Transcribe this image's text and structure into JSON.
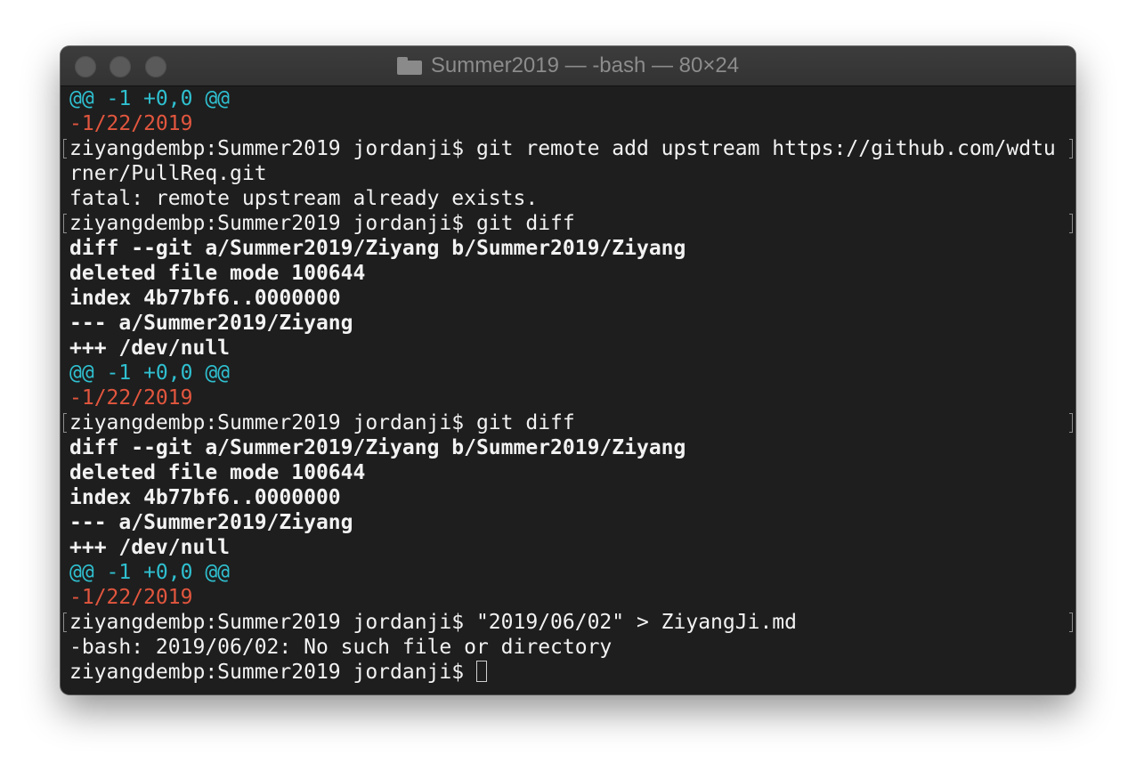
{
  "window": {
    "title": "Summer2019 — -bash — 80×24"
  },
  "terminal": {
    "lines": [
      {
        "text": "@@ -1 +0,0 @@",
        "style": "hunk"
      },
      {
        "text": "-1/22/2019",
        "style": "deleted"
      },
      {
        "text": "ziyangdembp:Summer2019 jordanji$ git remote add upstream https://github.com/wdtu",
        "style": "prompt"
      },
      {
        "text": "rner/PullReq.git",
        "style": "normal"
      },
      {
        "text": "fatal: remote upstream already exists.",
        "style": "normal"
      },
      {
        "text": "ziyangdembp:Summer2019 jordanji$ git diff",
        "style": "prompt"
      },
      {
        "text": "diff --git a/Summer2019/Ziyang b/Summer2019/Ziyang",
        "style": "bold"
      },
      {
        "text": "deleted file mode 100644",
        "style": "bold"
      },
      {
        "text": "index 4b77bf6..0000000",
        "style": "bold"
      },
      {
        "text": "--- a/Summer2019/Ziyang",
        "style": "bold"
      },
      {
        "text": "+++ /dev/null",
        "style": "bold"
      },
      {
        "text": "@@ -1 +0,0 @@",
        "style": "hunk"
      },
      {
        "text": "-1/22/2019",
        "style": "deleted"
      },
      {
        "text": "ziyangdembp:Summer2019 jordanji$ git diff",
        "style": "prompt"
      },
      {
        "text": "diff --git a/Summer2019/Ziyang b/Summer2019/Ziyang",
        "style": "bold"
      },
      {
        "text": "deleted file mode 100644",
        "style": "bold"
      },
      {
        "text": "index 4b77bf6..0000000",
        "style": "bold"
      },
      {
        "text": "--- a/Summer2019/Ziyang",
        "style": "bold"
      },
      {
        "text": "+++ /dev/null",
        "style": "bold"
      },
      {
        "text": "@@ -1 +0,0 @@",
        "style": "hunk"
      },
      {
        "text": "-1/22/2019",
        "style": "deleted"
      },
      {
        "text": "ziyangdembp:Summer2019 jordanji$ \"2019/06/02\" > ZiyangJi.md",
        "style": "prompt"
      },
      {
        "text": "-bash: 2019/06/02: No such file or directory",
        "style": "normal"
      },
      {
        "text": "ziyangdembp:Summer2019 jordanji$ ",
        "style": "current"
      }
    ]
  },
  "colors": {
    "hunk": "#2fc0d0",
    "deleted": "#e2563e",
    "text": "#f2f2f2",
    "background": "#1e1e1e"
  }
}
